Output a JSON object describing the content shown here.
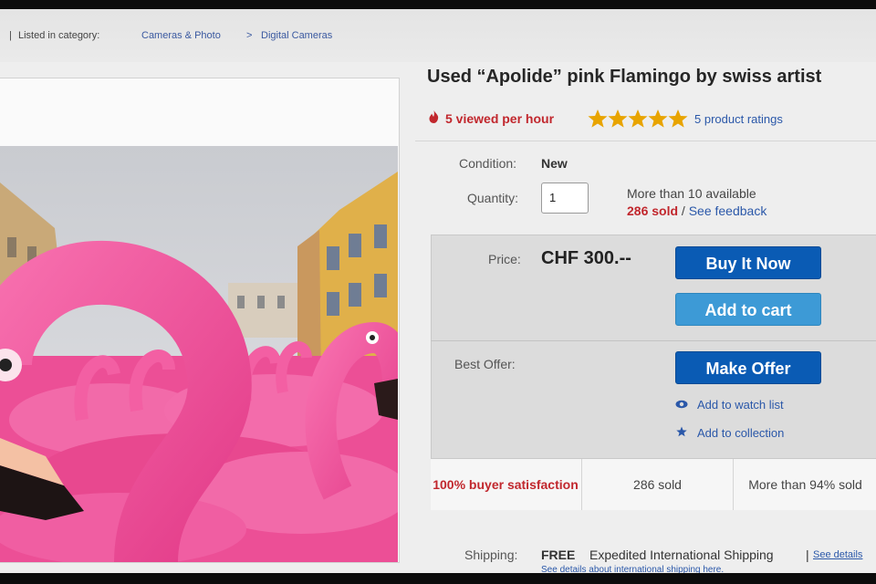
{
  "breadcrumb": {
    "separator": "|",
    "listed_label": "Listed in category:",
    "items": [
      "Cameras & Photo",
      "Digital Cameras"
    ],
    "arrow": ">"
  },
  "product": {
    "title": "Used “Apolide” pink Flamingo by swiss artist",
    "viewed": "5 viewed per hour",
    "rating_stars": 5,
    "ratings_text": "5 product ratings",
    "condition_label": "Condition:",
    "condition_value": "New",
    "quantity_label": "Quantity:",
    "quantity_value": "1",
    "availability": "More than 10 available",
    "sold": "286 sold",
    "sold_sep": " / ",
    "feedback": "See feedback"
  },
  "purchase": {
    "price_label": "Price:",
    "price_value": "CHF 300.--",
    "buy_now": "Buy It Now",
    "add_to_cart": "Add to cart",
    "best_offer_label": "Best Offer:",
    "make_offer": "Make Offer",
    "watch_list": "Add to watch list",
    "collection": "Add to collection"
  },
  "stats": [
    "100% buyer satisfaction",
    "286 sold",
    "More than 94% sold"
  ],
  "shipping": {
    "label": "Shipping:",
    "free": "FREE",
    "desc": "Expedited International Shipping",
    "bar": "|",
    "link": "See details",
    "note": "See details about international shipping here."
  },
  "colors": {
    "accent_red": "#c1272d",
    "link_blue": "#2b58a9",
    "button_blue": "#0a5bb4",
    "button_light_blue": "#3d9ad6",
    "star_gold": "#e8a400",
    "flamingo_pink": "#f0559c"
  },
  "icons": {
    "viewed": "fire-icon",
    "rating": "star-icon",
    "watch": "eye-icon",
    "collection": "star-icon"
  }
}
